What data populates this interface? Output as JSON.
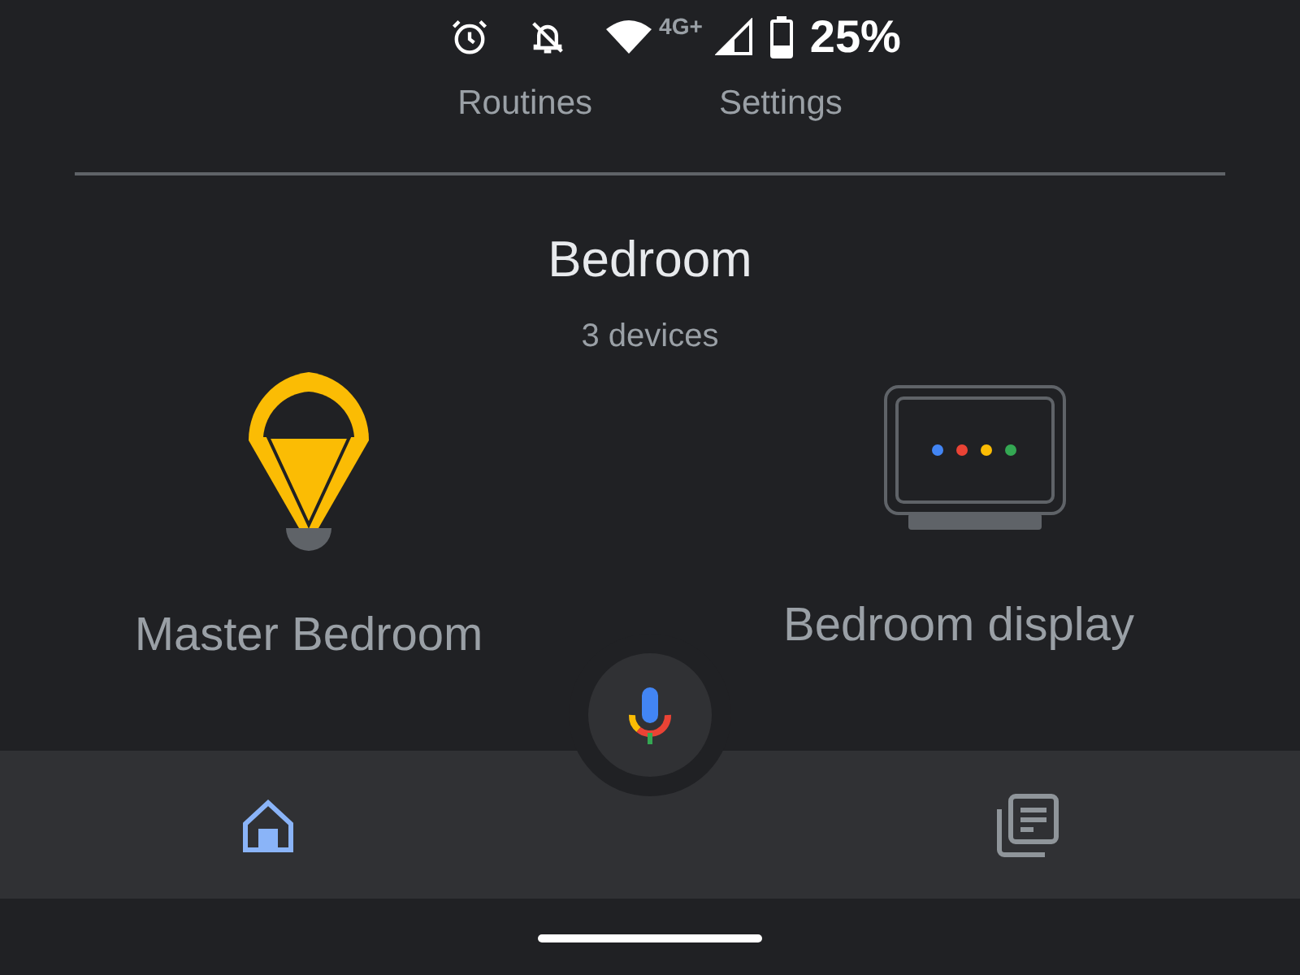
{
  "status_bar": {
    "network": "4G+",
    "battery": "25%"
  },
  "top_tabs": [
    "Routines",
    "Settings"
  ],
  "room": {
    "title": "Bedroom",
    "subtitle": "3 devices"
  },
  "devices": [
    {
      "kind": "light",
      "name": "Master Bedroom",
      "on": true
    },
    {
      "kind": "display",
      "name": "Bedroom display"
    }
  ],
  "nav": [
    {
      "kind": "home",
      "selected": true
    },
    {
      "kind": "feed",
      "selected": false
    }
  ]
}
